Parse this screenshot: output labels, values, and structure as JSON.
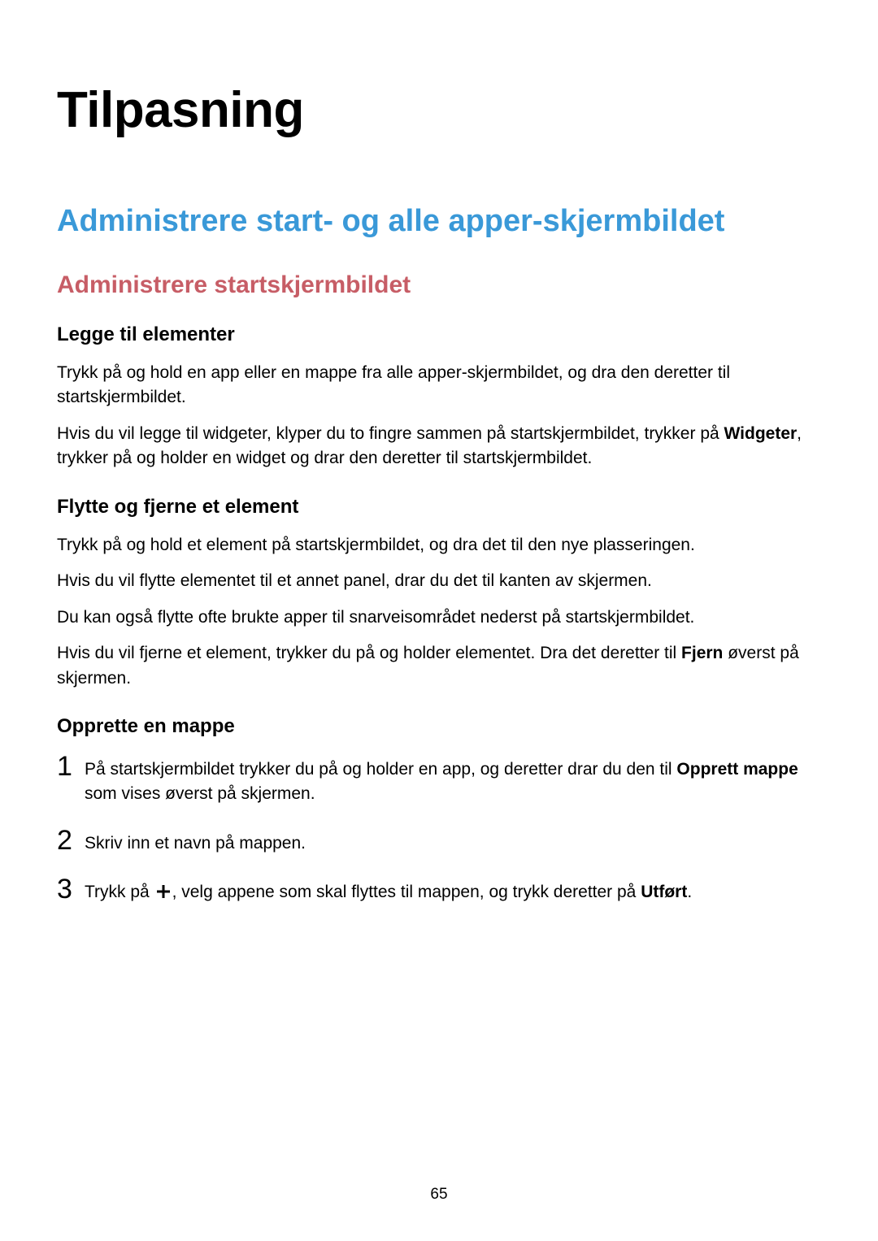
{
  "page_title": "Tilpasning",
  "section_title": "Administrere start- og alle apper-skjermbildet",
  "subsection_title": "Administrere startskjermbildet",
  "block1": {
    "heading": "Legge til elementer",
    "p1": "Trykk på og hold en app eller en mappe fra alle apper-skjermbildet, og dra den deretter til startskjermbildet.",
    "p2a": "Hvis du vil legge til widgeter, klyper du to fingre sammen på startskjermbildet, trykker på ",
    "p2_bold": "Widgeter",
    "p2b": ", trykker på og holder en widget og drar den deretter til startskjermbildet."
  },
  "block2": {
    "heading": "Flytte og fjerne et element",
    "p1": "Trykk på og hold et element på startskjermbildet, og dra det til den nye plasseringen.",
    "p2": "Hvis du vil flytte elementet til et annet panel, drar du det til kanten av skjermen.",
    "p3": "Du kan også flytte ofte brukte apper til snarveisområdet nederst på startskjermbildet.",
    "p4a": "Hvis du vil fjerne et element, trykker du på og holder elementet. Dra det deretter til ",
    "p4_bold": "Fjern",
    "p4b": " øverst på skjermen."
  },
  "block3": {
    "heading": "Opprette en mappe",
    "step1_num": "1",
    "step1_a": "På startskjermbildet trykker du på og holder en app, og deretter drar du den til ",
    "step1_bold": "Opprett mappe",
    "step1_b": " som vises øverst på skjermen.",
    "step2_num": "2",
    "step2": "Skriv inn et navn på mappen.",
    "step3_num": "3",
    "step3_a": "Trykk på ",
    "step3_b": ", velg appene som skal flyttes til mappen, og trykk deretter på ",
    "step3_bold": "Utført",
    "step3_c": "."
  },
  "page_number": "65"
}
